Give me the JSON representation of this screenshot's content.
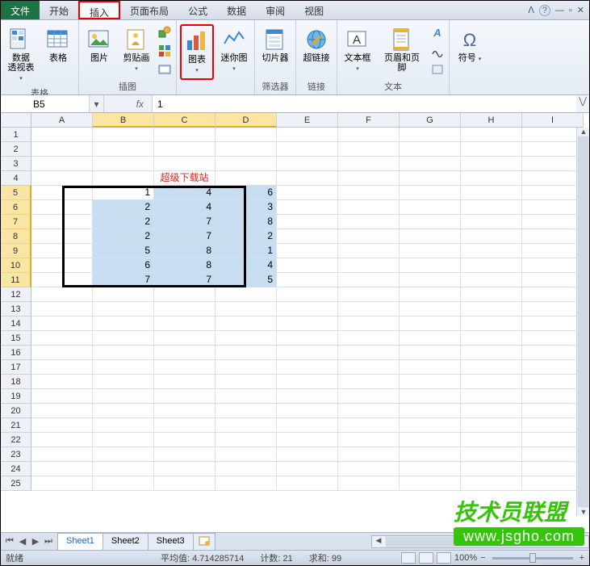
{
  "tabs": {
    "file": "文件",
    "home": "开始",
    "insert": "插入",
    "layout": "页面布局",
    "formulas": "公式",
    "data": "数据",
    "review": "审阅",
    "view": "视图"
  },
  "ribbon": {
    "groups": {
      "table_lbl": "表格",
      "pivot": "数据\n透视表",
      "table": "表格",
      "ill_lbl": "插图",
      "picture": "图片",
      "clipart": "剪贴画",
      "chart_lbl": "",
      "chart": "图表",
      "spark": "迷你图",
      "filter_lbl": "筛选器",
      "slicer": "切片器",
      "link_lbl": "链接",
      "hyper": "超链接",
      "text_lbl": "文本",
      "textbox": "文本框",
      "hf": "页眉和页脚",
      "sym_lbl": "",
      "symbol": "符号"
    }
  },
  "namebox": "B5",
  "formula": "1",
  "cols": [
    "A",
    "B",
    "C",
    "D",
    "E",
    "F",
    "G",
    "H",
    "I"
  ],
  "row_count": 25,
  "header_text": "超级下载站",
  "table_data": [
    [
      1,
      4,
      6
    ],
    [
      2,
      4,
      3
    ],
    [
      2,
      7,
      8
    ],
    [
      2,
      7,
      2
    ],
    [
      5,
      8,
      1
    ],
    [
      6,
      8,
      4
    ],
    [
      7,
      7,
      5
    ]
  ],
  "sheets": [
    "Sheet1",
    "Sheet2",
    "Sheet3"
  ],
  "status": {
    "ready": "就绪",
    "avg_lbl": "平均值:",
    "avg": "4.714285714",
    "cnt_lbl": "计数:",
    "cnt": "21",
    "sum_lbl": "求和:",
    "sum": "99",
    "zoom": "100%"
  },
  "watermark": {
    "t1": "技术员联盟",
    "t2": "www.jsgho.com"
  }
}
